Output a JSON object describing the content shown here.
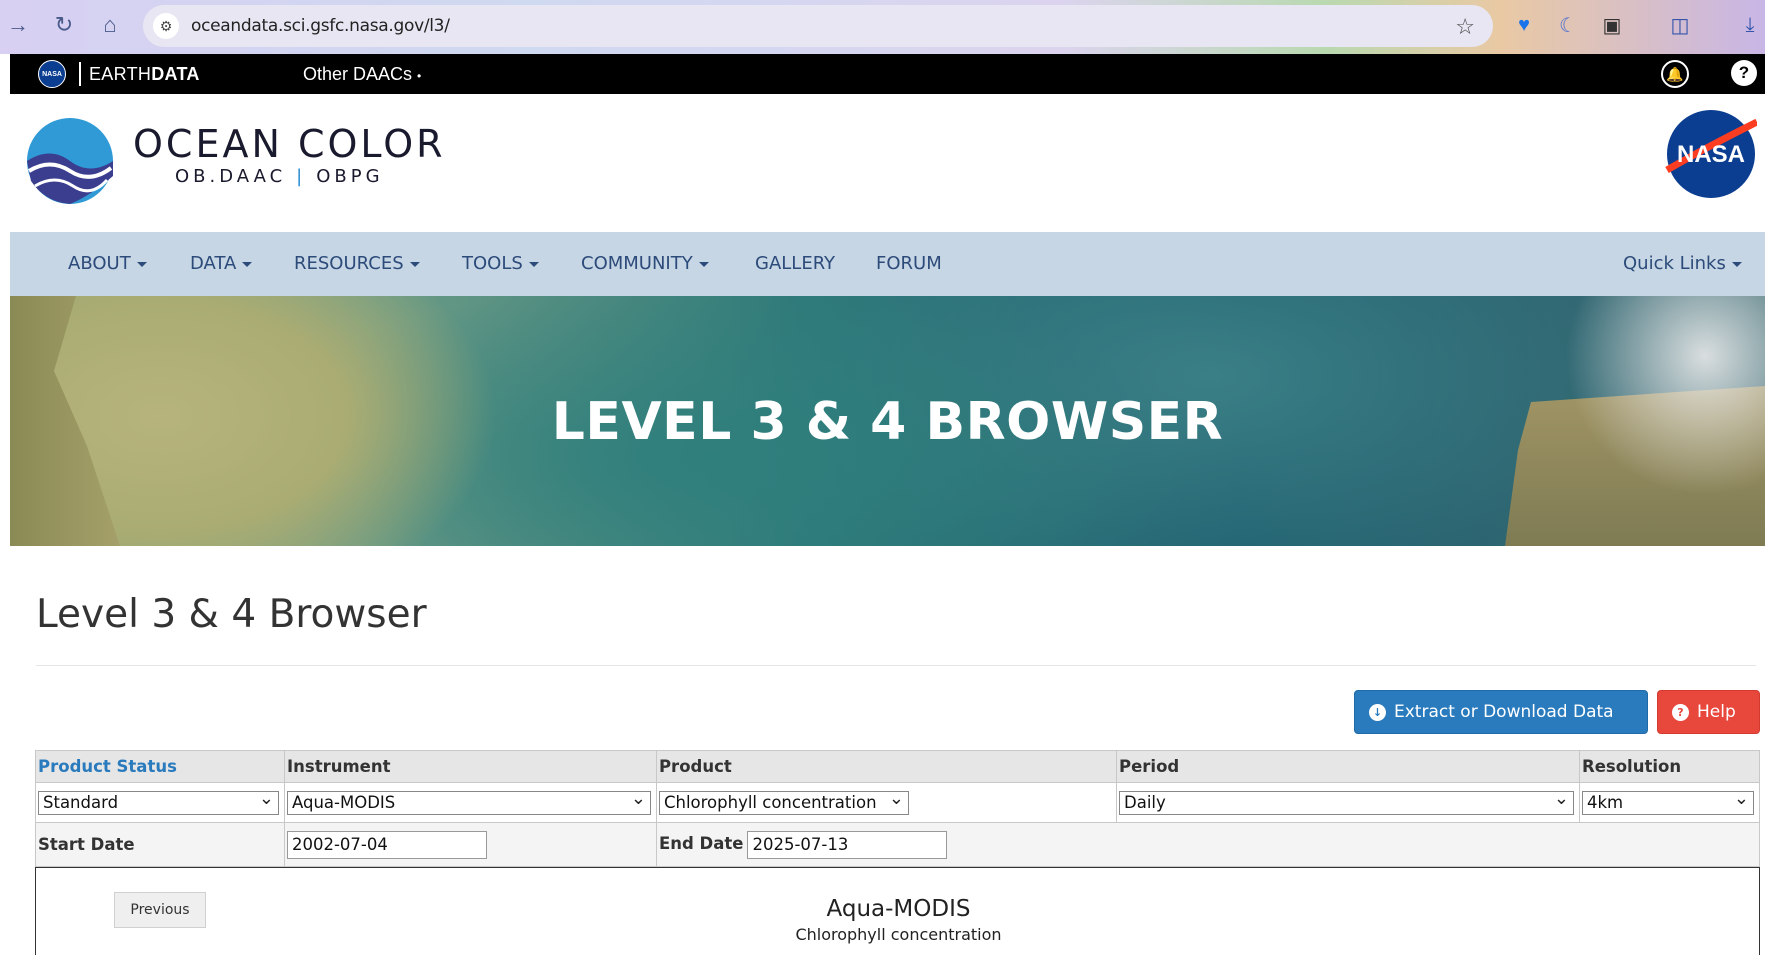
{
  "browser": {
    "url": "oceandata.sci.gsfc.nasa.gov/l3/"
  },
  "earthdata": {
    "brand_prefix": "EARTH",
    "brand_bold": "DATA",
    "other_daacs": "Other DAACs"
  },
  "header": {
    "title": "OCEAN COLOR",
    "sub_left": "OB.DAAC",
    "sub_sep": "|",
    "sub_right": "OBPG",
    "nasa_text": "NASA"
  },
  "nav": {
    "items": [
      "ABOUT",
      "DATA",
      "RESOURCES",
      "TOOLS",
      "COMMUNITY",
      "GALLERY",
      "FORUM"
    ],
    "quick_links": "Quick Links"
  },
  "hero": {
    "title": "LEVEL 3 & 4 BROWSER"
  },
  "page": {
    "title": "Level 3 & 4 Browser"
  },
  "buttons": {
    "extract": "Extract or Download Data",
    "help": "Help"
  },
  "form": {
    "headers": {
      "product_status": "Product Status",
      "instrument": "Instrument",
      "product": "Product",
      "period": "Period",
      "resolution": "Resolution"
    },
    "values": {
      "product_status": "Standard",
      "instrument": "Aqua-MODIS",
      "product": "Chlorophyll concentration",
      "period": "Daily",
      "resolution": "4km"
    },
    "start_date_label": "Start Date",
    "start_date": "2002-07-04",
    "end_date_label": "End Date",
    "end_date": "2025-07-13"
  },
  "viewer": {
    "previous": "Previous",
    "instrument": "Aqua-MODIS",
    "product": "Chlorophyll concentration"
  },
  "colors": {
    "nav_bg": "#c6d6e4",
    "link_blue": "#2a7bbd",
    "help_red": "#e8473c",
    "nasa_blue": "#0b3d91"
  }
}
